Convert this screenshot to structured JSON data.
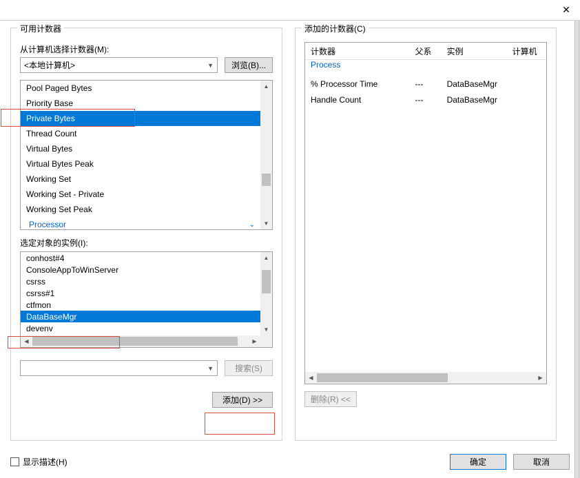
{
  "left": {
    "group_title": "可用计数器",
    "from_label": "从计算机选择计数器(M):",
    "computer_value": "<本地计算机>",
    "browse_label": "浏览(B)...",
    "counters": [
      "Pool Paged Bytes",
      "Priority Base",
      "Private Bytes",
      "Thread Count",
      "Virtual Bytes",
      "Virtual Bytes Peak",
      "Working Set",
      "Working Set - Private",
      "Working Set Peak"
    ],
    "counter_category": "Processor",
    "selected_counter_index": 2,
    "instances_label": "选定对象的实例(I):",
    "instances": [
      "conhost#4",
      "ConsoleAppToWinServer",
      "csrss",
      "csrss#1",
      "ctfmon",
      "DataBaseMgr",
      "devenv"
    ],
    "selected_instance_index": 5,
    "search_label": "搜索(S)",
    "add_label": "添加(D) >>"
  },
  "right": {
    "group_title": "添加的计数器(C)",
    "headers": {
      "counter": "计数器",
      "parent": "父系",
      "instance": "实例",
      "computer": "计算机"
    },
    "category": "Process",
    "rows": [
      {
        "counter": "% Processor Time",
        "parent": "---",
        "instance": "DataBaseMgr"
      },
      {
        "counter": "Handle Count",
        "parent": "---",
        "instance": "DataBaseMgr"
      }
    ],
    "remove_label": "删除(R) <<"
  },
  "bottom": {
    "show_desc": "显示描述(H)",
    "ok": "确定",
    "cancel": "取消"
  }
}
